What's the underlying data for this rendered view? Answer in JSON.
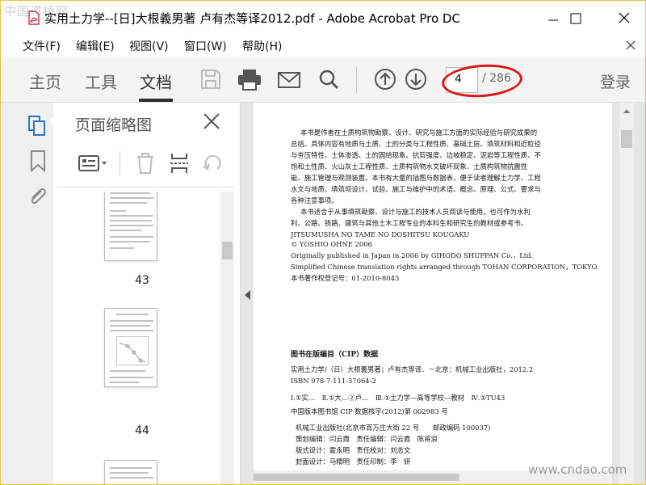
{
  "watermark": {
    "top_left": "中国道桥网",
    "bottom_right": "www.cndao.com"
  },
  "window": {
    "title": "实用土力学--[日]大根義男著 卢有杰等译2012.pdf - Adobe Acrobat Pro DC"
  },
  "menu": {
    "items": [
      {
        "label": "文件(F)"
      },
      {
        "label": "编辑(E)"
      },
      {
        "label": "视图(V)"
      },
      {
        "label": "窗口(W)"
      },
      {
        "label": "帮助(H)"
      }
    ]
  },
  "toolbar": {
    "tabs": [
      {
        "label": "主页"
      },
      {
        "label": "工具"
      },
      {
        "label": "文档"
      }
    ],
    "active_tab": "文档",
    "page_current": "4",
    "page_total": "/ 286",
    "login_label": "登录",
    "icons": [
      "save-icon",
      "print-icon",
      "email-icon",
      "search-icon",
      "page-up-icon",
      "page-down-icon"
    ]
  },
  "thumbnails_panel": {
    "title": "页面缩略图",
    "pages": [
      {
        "label": "43"
      },
      {
        "label": "44"
      }
    ]
  },
  "document": {
    "lines": [
      "本书是作者在土质构筑物勘察、设计、研究与施工方面的实际经验与研究成果的",
      "总结。具体内容有地质与土质、土的分类与工程性质、基础土层、填筑材料和近粒径",
      "与夯压特性、土体渗透、土的固结现象、抗剪强度、边坡稳定、泥岩等工程性质、不",
      "饱和土性质、火山灰土工程性质、土质构筑物水文破坏现象、土质构筑物抗震性",
      "能、施工管理与观测装置。本书有大量的插图与数据表，便于读者理解土力学、工程",
      "水文与地质、填筑坝设计、试验、施工与维护中的术语、概念、原理、公式、要求与",
      "各种注意事项。",
      "本书适合于从事填筑勘察、设计与施工的技术人员阅读与使用，也可作为水利",
      "利、公路、铁路、建筑与其他土木工程专业的本科生和研究生的教材或参考书。",
      "JITSUMUSHA NO TAME NO DOSHITSU KOUGAKU",
      "© YOSHIO OHNE 2006",
      "Originally published in Japan in 2006 by GIHODO SHUPPAN Co.，Ltd.",
      "Simplified Chinese translation rights arranged through TOHAN CORPORATION，TOKYO.",
      "本书著作权登记号：01-2010-8043",
      "图书在版编目（CIP）数据",
      "实用土力学/（日）大根義男著；卢有杰等译．－北京：机械工业出版社，2012.2",
      "ISBN 978-7-111-37064-2",
      "Ⅰ.①实…　Ⅱ.①大…②卢…　Ⅲ.①土力学—高等学校—教材　Ⅳ.①TU43",
      "中国版本图书馆 CIP 数据核字(2012)第 002983 号",
      "机械工业出版社(北京市百万庄大街 22 号　　邮政编码 100037)",
      "策划编辑：闫云霞　责任编辑：闫云霞　陈将浪",
      "版式设计：霍永明　责任校对：刘志文",
      "封面设计：马精明　责任印制：李　妍"
    ]
  }
}
